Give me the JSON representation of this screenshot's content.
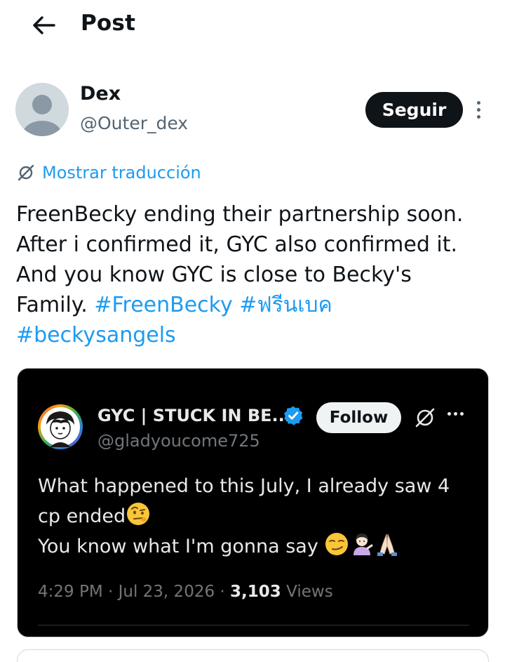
{
  "header": {
    "title": "Post"
  },
  "author": {
    "name": "Dex",
    "handle": "@Outer_dex",
    "follow_label": "Seguir"
  },
  "translate": {
    "label": "Mostrar traducción"
  },
  "tweet": {
    "line1": "FreenBecky ending their partnership soon.",
    "line2": "After i confirmed it, GYC also confirmed it.",
    "line3": "And you know GYC is close to Becky's",
    "line4_text": "Family. ",
    "hashtag1": "#FreenBecky",
    "hashtag2": "#ฟรีนเบค",
    "hashtag3": "#beckysangels"
  },
  "quote": {
    "name": "GYC | STUCK IN BE...",
    "handle": "@gladyoucome725",
    "follow_label": "Follow",
    "line1": "What happened to this July, I already saw 4",
    "line2": "cp ended",
    "line3": "You know what I'm gonna say ",
    "time": "4:29 PM · Jul 23, 2026 · ",
    "views_count": "3,103",
    "views_label": " Views"
  },
  "icons": {
    "back": "arrow-left-icon",
    "translate": "globe-slash-icon",
    "more": "more-vertical-icon",
    "verified": "verified-badge-icon",
    "grok": "grok-icon",
    "emojis": [
      "face-with-raised-eyebrow",
      "smirking-face",
      "person-tipping-hand",
      "folded-hands"
    ]
  },
  "colors": {
    "accent": "#1d9bf0",
    "text_primary": "#0f1419",
    "text_secondary": "#536471",
    "quote_bg": "#000000"
  }
}
